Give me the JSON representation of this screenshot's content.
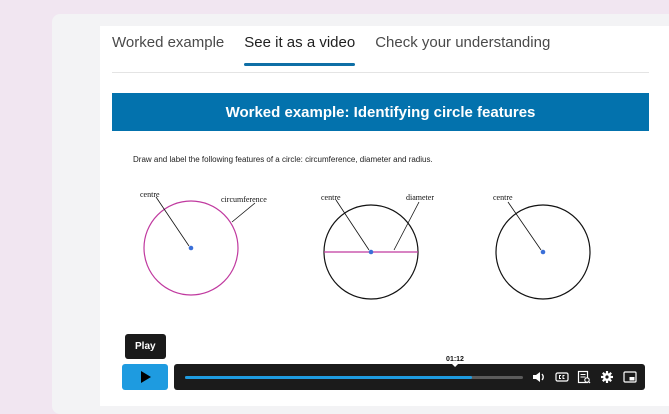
{
  "tabs": [
    {
      "label": "Worked example",
      "active": false
    },
    {
      "label": "See it as a video",
      "active": true
    },
    {
      "label": "Check your understanding",
      "active": false
    }
  ],
  "video": {
    "title": "Worked example: Identifying circle features",
    "instructions": "Draw and label the following features of a circle: circumference, diameter and radius.",
    "circles": [
      {
        "labels": [
          "centre",
          "circumference"
        ],
        "outline_color": "#c0399f"
      },
      {
        "labels": [
          "centre",
          "diameter"
        ],
        "outline_color": "#111111",
        "diameter_color": "#c0399f"
      },
      {
        "labels": [
          "centre"
        ],
        "outline_color": "#111111"
      }
    ]
  },
  "player": {
    "tooltip": "Play",
    "current_time": "01:12",
    "progress": 0.85,
    "accent": "#1e9be0",
    "icons": [
      "play-icon",
      "volume-icon",
      "captions-icon",
      "transcript-icon",
      "settings-icon",
      "picture-in-picture-icon"
    ]
  }
}
